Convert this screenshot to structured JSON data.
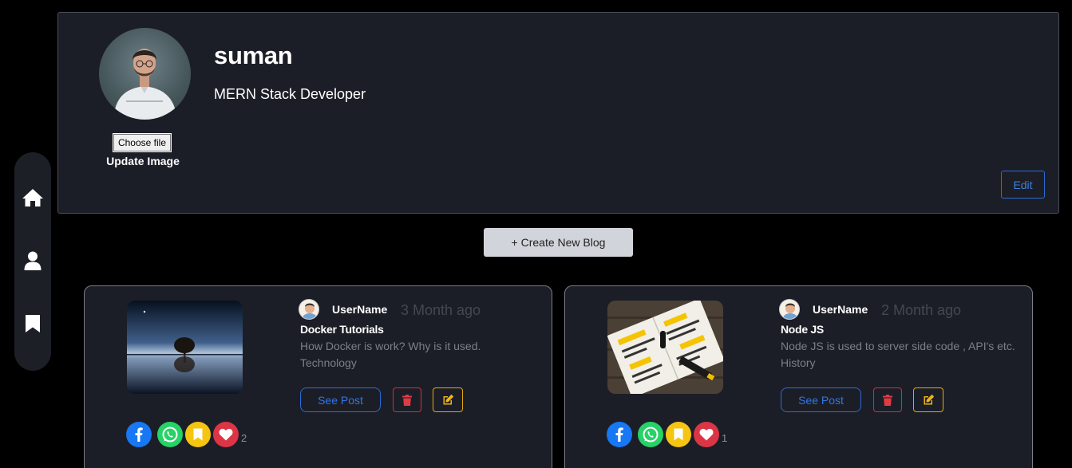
{
  "profile": {
    "name": "suman",
    "title": "MERN Stack Developer",
    "choose_file_label": "Choose file",
    "update_image_label": "Update Image",
    "edit_label": "Edit"
  },
  "create_blog_label": "+ Create New Blog",
  "sidebar": {
    "items": [
      {
        "icon": "home-icon"
      },
      {
        "icon": "user-icon"
      },
      {
        "icon": "bookmark-icon"
      }
    ]
  },
  "posts": [
    {
      "author": "UserName",
      "time": "3 Month ago",
      "title": "Docker Tutorials",
      "description": "How Docker is work? Why is it used.",
      "category": "Technology",
      "see_post_label": "See Post",
      "likes": "2"
    },
    {
      "author": "UserName",
      "time": "2 Month ago",
      "title": "Node JS",
      "description": "Node JS is used to server side code , API's etc.",
      "category": "History",
      "see_post_label": "See Post",
      "likes": "1"
    }
  ],
  "colors": {
    "background": "#000000",
    "card": "#1c1e27",
    "primary": "#2f77e6",
    "danger": "#dc3545",
    "warning": "#f5c511",
    "facebook": "#1877f2",
    "whatsapp": "#25d366"
  }
}
